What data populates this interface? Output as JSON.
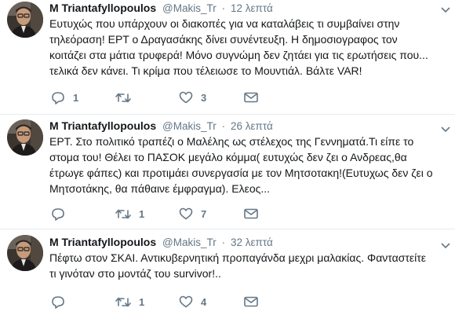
{
  "tweets": [
    {
      "name": "M Triantafyllopoulos",
      "handle": "@Makis_Tr",
      "dot": "·",
      "time": "12 λεπτά",
      "lines": [
        "Ευτυχώς που υπάρχουν οι διακοπές για να καταλάβεις τι συμβαίνει στην",
        "τηλεόραση! ΕΡΤ ο Δραγασάκης δίνει συνέντευξη. Η δημοσιογραφος τον",
        "κοιτάζει στα μάτια τρυφερά! Μόνο συγνώμη δεν ζητάει για τις ερωτήσεις που...",
        "τελικά δεν κάνει. Τι κρίμα που τέλειωσε το Μουντιάλ. Βάλτε VAR!"
      ],
      "reply_count": "1",
      "retweet_count": "",
      "like_count": "3"
    },
    {
      "name": "M Triantafyllopoulos",
      "handle": "@Makis_Tr",
      "dot": "·",
      "time": "26 λεπτά",
      "lines": [
        "ΕΡΤ. Στο πολιτικό τραπέζι ο Μαλέλης ως στέλεχος της Γεννηματά.Τι είπε το",
        "στομα του! Θέλει το ΠΑΣΟΚ μεγάλο κόμμα( ευτυχώς δεν ζει ο Ανδρεας,θα",
        "έτρωγε φάπες) και προτιμάει συνεργασία με τον Μητσοτακη!(Ευτυχως δεν ζει ο",
        "Μητσοτάκης, θα πάθαινε έμφραγμα). Ελεος..."
      ],
      "reply_count": "",
      "retweet_count": "1",
      "like_count": "7"
    },
    {
      "name": "M Triantafyllopoulos",
      "handle": "@Makis_Tr",
      "dot": "·",
      "time": "32 λεπτά",
      "lines": [
        "Πέφτω στον ΣΚΑΙ. Αντικυβερνητική προπαγάνδα μεχρι μαλακίας. Φανταστείτε",
        "τι γινόταν στο μοντάζ του survivor!.."
      ],
      "reply_count": "",
      "retweet_count": "1",
      "like_count": "4"
    }
  ],
  "colors": {
    "text": "#14171a",
    "secondary": "#657786",
    "divider": "#e6ecf0"
  }
}
